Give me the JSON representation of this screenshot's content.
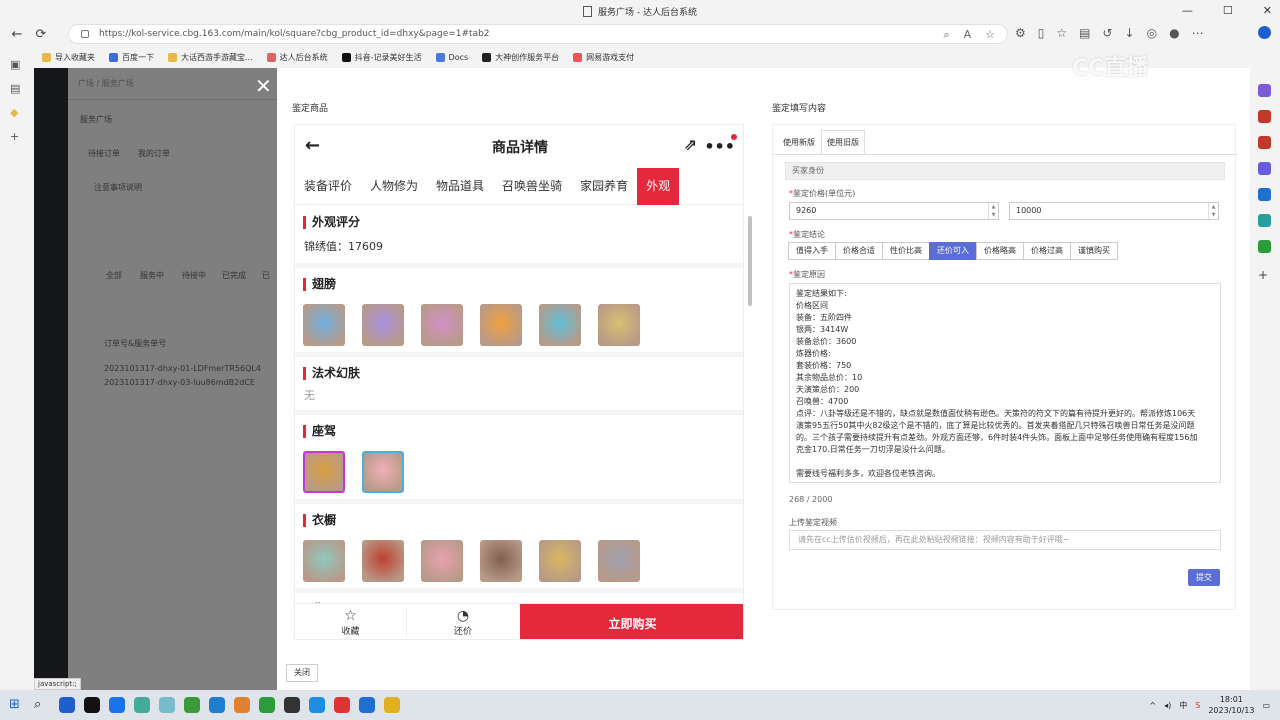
{
  "window": {
    "title": "服务广场 - 达人后台系统",
    "minimize": "—",
    "maximize": "☐",
    "close": "✕"
  },
  "browser": {
    "url": "https://kol-service.cbg.163.com/main/kol/square?cbg_product_id=dhxy&page=1#tab2",
    "back": "←",
    "reload": "⟳"
  },
  "bookmarks": [
    {
      "label": "导入收藏夹",
      "color": "#e8b84a"
    },
    {
      "label": "百度一下",
      "color": "#3b6be0"
    },
    {
      "label": "大话西游手游藏宝...",
      "color": "#e8b84a"
    },
    {
      "label": "达人后台系统",
      "color": "#d66"
    },
    {
      "label": "抖音-记录美好生活",
      "color": "#111"
    },
    {
      "label": "Docs",
      "color": "#4a7be0"
    },
    {
      "label": "大神创作服务平台",
      "color": "#222"
    },
    {
      "label": "网易游戏支付",
      "color": "#e55"
    }
  ],
  "background_page": {
    "breadcrumb": "广场 / 服务广场",
    "title": "服务广场",
    "tabs": [
      "待接订单",
      "我的订单"
    ],
    "notice": "注意事项说明",
    "filters": [
      "全部",
      "服务中",
      "待接中",
      "已完成",
      "已"
    ],
    "list_header": "订单号&服务单号",
    "orders": [
      "2023101317-dhxy-01-LDFmerTR56QL4",
      "2023101317-dhxy-03-luu86mdB2dCE"
    ]
  },
  "modal": {
    "left_title": "鉴定商品",
    "right_title": "鉴定填写内容",
    "close_label": "关闭"
  },
  "product": {
    "header": "商品详情",
    "tabs": [
      {
        "label": "装备评价",
        "active": false
      },
      {
        "label": "人物修为",
        "active": false
      },
      {
        "label": "物品道具",
        "active": false
      },
      {
        "label": "召唤兽坐骑",
        "active": false
      },
      {
        "label": "家园养育",
        "active": false
      },
      {
        "label": "外观",
        "active": true
      }
    ],
    "score_title": "外观评分",
    "score_value": "锦绣值：17609",
    "wings_title": "翅膀",
    "wings": [
      "#6fb0e0",
      "#a88fe0",
      "#d38fc7",
      "#f0a040",
      "#60c0d8",
      "#d8c070"
    ],
    "skin_title": "法术幻肤",
    "skin_value": "无",
    "mount_title": "座驾",
    "mounts": [
      "#d9a040",
      "#f0b0b8"
    ],
    "wardrobe_title": "衣橱",
    "wardrobe": [
      "#8fc8c0",
      "#c04030",
      "#e8a0b0",
      "#806050",
      "#d8b860",
      "#a0a0b0"
    ],
    "next_title": "背景",
    "favorite": "收藏",
    "bargain": "还价",
    "buy_now": "立即购买"
  },
  "form": {
    "tabs": [
      {
        "label": "使用新版",
        "active": false
      },
      {
        "label": "使用旧版",
        "active": true
      }
    ],
    "section": "买家身份",
    "price_label": "鉴定价格(单位元)",
    "price_min": "9260",
    "price_max": "10000",
    "conclusion_label": "鉴定结论",
    "conclusions": [
      {
        "label": "值得入手",
        "active": false
      },
      {
        "label": "价格合适",
        "active": false
      },
      {
        "label": "性价比高",
        "active": false
      },
      {
        "label": "还价可入",
        "active": true
      },
      {
        "label": "价格略高",
        "active": false
      },
      {
        "label": "价格过高",
        "active": false
      },
      {
        "label": "谨慎购买",
        "active": false
      }
    ],
    "reason_label": "鉴定原因",
    "reason_lines": [
      "鉴定结果如下:",
      "价格区间",
      "装备：五阶四件",
      "银两：3414W",
      "装备总价：3600",
      "炼器价格:",
      "套装价格：750",
      "其余物品总价：10",
      "天演策总价：200",
      "召唤兽：4700",
      "点评：八卦等级还是不错的，缺点就是数值面仗稍有逊色。天策符的符文下的篇有待提升更好的。帮派修炼106天",
      "演策95五行50其中火82级这个是不错的，底了算是比较优秀的。首发夹着搭配几只特殊召唤兽日常任务是没问题",
      "的。三个孩子需要持续提升有点差劲。外观方面还够，6件时装4件头饰。面板上面中足够任务使用确有程度156加",
      "克金170.日常任务一刀切浮是没什么问题。",
      "",
      "需要线号福利多多，欢迎各位老铁咨询。"
    ],
    "count": "268 / 2000",
    "video_label": "上传鉴定视频",
    "video_placeholder": "请先在cc上传估价视频后，再在此处粘贴视频链接：视频内容有助于好评哦~",
    "submit": "提交"
  },
  "status_bar": "javascript:;",
  "watermark": "CC直播",
  "tray": {
    "lang": "中",
    "time": "18:01",
    "date": "2023/10/13"
  },
  "taskbar_icons": [
    "#1e5fd0",
    "#111",
    "#1a73e8",
    "#4a9",
    "#7bc",
    "#3a9a3a",
    "#1e7fd0",
    "#e08030",
    "#2a9d3a",
    "#333",
    "#1e8fe0",
    "#d33",
    "#1e6fd0",
    "#e0b020"
  ]
}
